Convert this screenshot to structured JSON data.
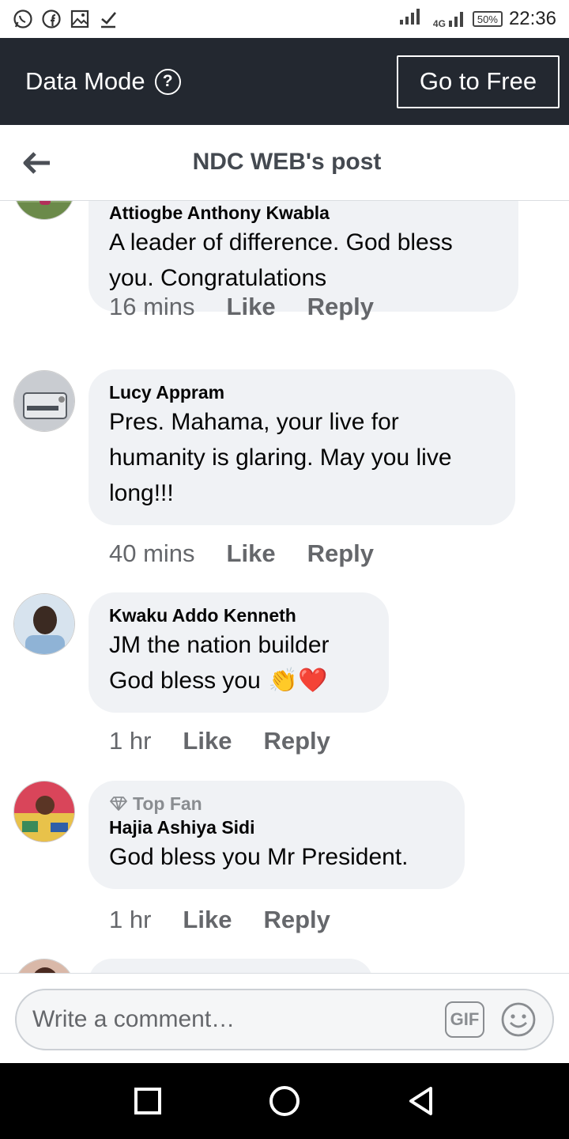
{
  "status_bar": {
    "network": "4G",
    "battery": "50%",
    "time": "22:36"
  },
  "data_mode": {
    "title": "Data Mode",
    "help_symbol": "?",
    "go_button": "Go to Free"
  },
  "header": {
    "title": "NDC WEB's post"
  },
  "comments": [
    {
      "author": "Attiogbe Anthony Kwabla",
      "text": "A leader of difference. God bless you. Congratulations",
      "time": "16 mins",
      "like": "Like",
      "reply": "Reply"
    },
    {
      "author": "Lucy Appram",
      "text": "Pres. Mahama, your live for humanity is glaring. May you live long!!!",
      "time": "40 mins",
      "like": "Like",
      "reply": "Reply"
    },
    {
      "author": "Kwaku Addo Kenneth",
      "text_line1": "JM the nation builder",
      "text_line2": "God bless you",
      "emoji": "👏❤️",
      "time": "1 hr",
      "like": "Like",
      "reply": "Reply"
    },
    {
      "badge": "Top Fan",
      "author": "Hajia Ashiya Sidi",
      "text": "God bless you Mr President.",
      "time": "1 hr",
      "like": "Like",
      "reply": "Reply"
    }
  ],
  "composer": {
    "placeholder": "Write a comment…",
    "gif_label": "GIF"
  }
}
